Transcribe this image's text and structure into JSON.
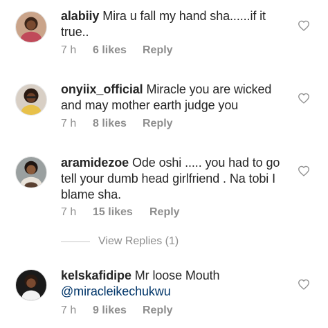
{
  "comments": [
    {
      "username": "alabiiy",
      "text": "Mira u fall my hand sha......if it true..",
      "time": "7 h",
      "likes": "6 likes",
      "reply": "Reply"
    },
    {
      "username": "onyiix_official",
      "text": "Miracle you are wicked and may mother earth judge you",
      "time": "7 h",
      "likes": "8 likes",
      "reply": "Reply"
    },
    {
      "username": "aramidezoe",
      "text": "Ode oshi ..... you had to go tell your dumb head girlfriend . Na tobi I blame sha.",
      "time": "7 h",
      "likes": "15 likes",
      "reply": "Reply"
    },
    {
      "username": "kelskafidipe",
      "text": "Mr loose Mouth ",
      "mention": "@miracleikechukwu",
      "time": "7 h",
      "likes": "9 likes",
      "reply": "Reply"
    }
  ],
  "view_replies": "View Replies (1)",
  "icons": {
    "like": "heart-outline-icon"
  },
  "colors": {
    "text": "#262626",
    "muted": "#8e8e8e",
    "mention": "#003569"
  }
}
